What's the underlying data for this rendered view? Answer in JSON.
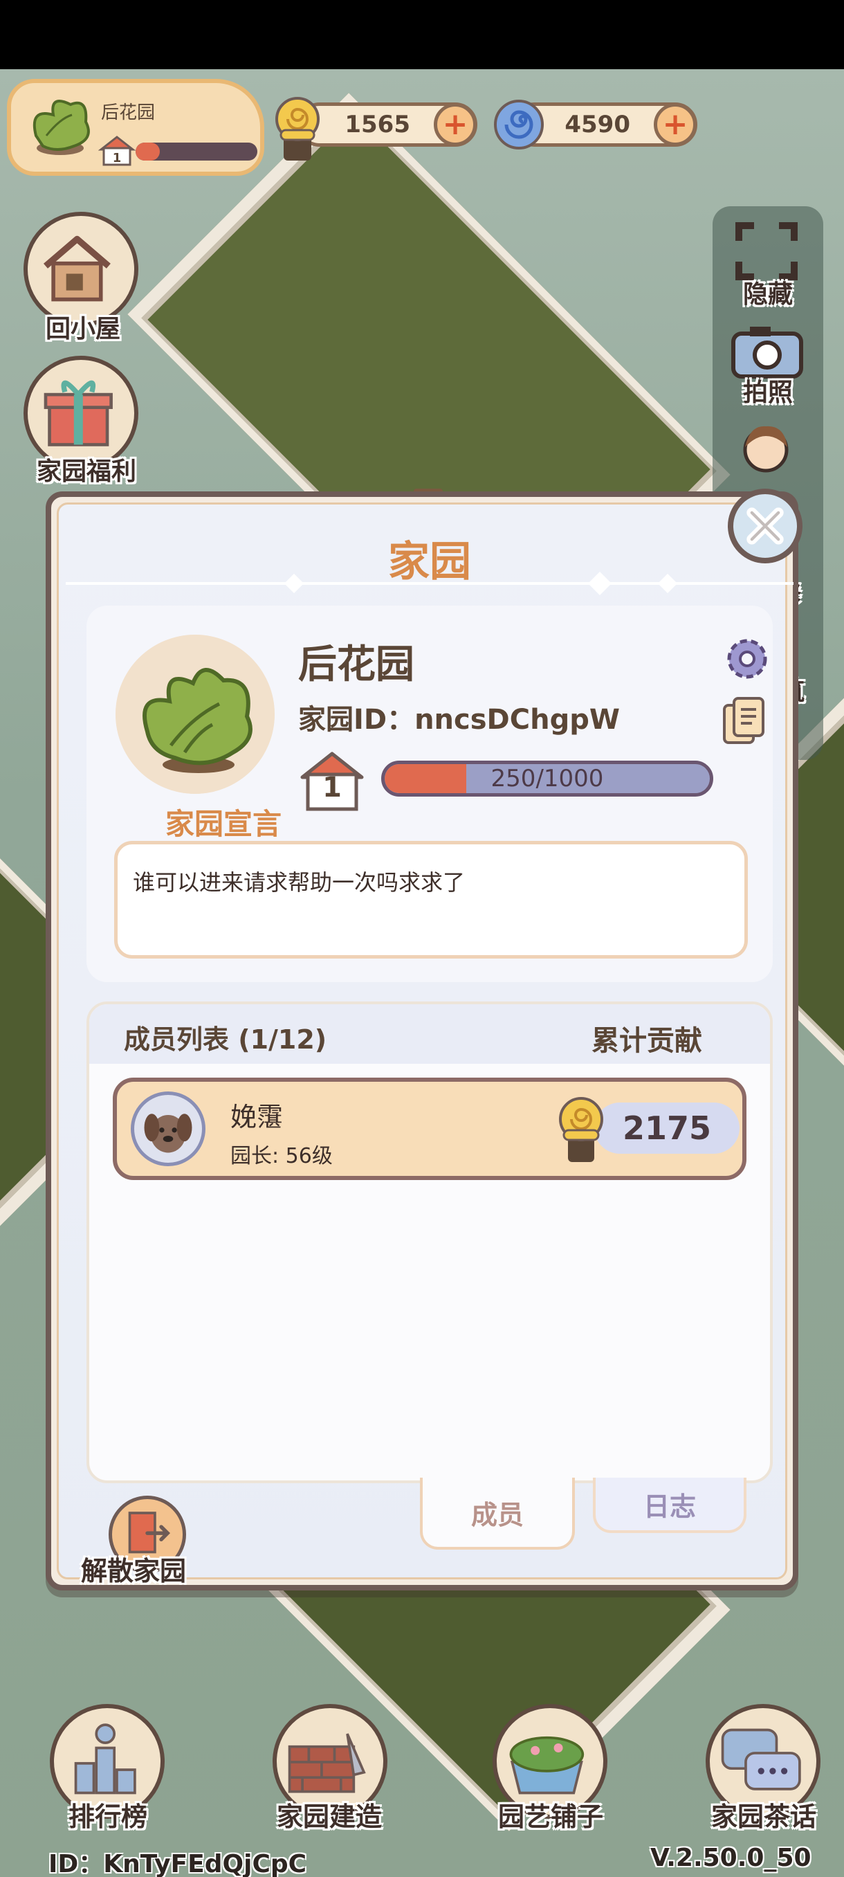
{
  "header": {
    "garden_name": "后花园",
    "garden_level": "1",
    "garden_progress": 0.2,
    "snail_coins": "1565",
    "swirl_coins": "4590",
    "plus_symbol": "+"
  },
  "side_left": {
    "home_label": "回小屋",
    "welfare_label": "家园福利"
  },
  "side_right": {
    "hide_label": "隐藏",
    "photo_label": "拍照",
    "partial_1": "修",
    "partial_2": "筑"
  },
  "dialog": {
    "title": "家园",
    "garden_name": "后花园",
    "garden_id": "家园ID：nncsDChgpW",
    "level": "1",
    "progress_text": "250/1000",
    "progress_value": 0.25,
    "declaration_title": "家园宣言",
    "declaration_text": "谁可以进来请求帮助一次吗求求了",
    "member_list_title": "成员列表 (1/12)",
    "contribution_title": "累计贡献",
    "members": [
      {
        "name": "娩霮",
        "role": "园长: 56级",
        "score": "2175"
      }
    ],
    "tabs": {
      "members": "成员",
      "log": "日志"
    },
    "disband_label": "解散家园"
  },
  "bottom_nav": {
    "ranking": "排行榜",
    "build": "家园建造",
    "shop": "园艺铺子",
    "chat": "家园茶话"
  },
  "footer": {
    "user_id": "ID：KnTyFEdQjCpC",
    "version": "V.2.50.0_50"
  },
  "colors": {
    "accent_orange": "#d98a4a",
    "progress_red": "#e06a4f",
    "outline_brown": "#6e5b56"
  }
}
